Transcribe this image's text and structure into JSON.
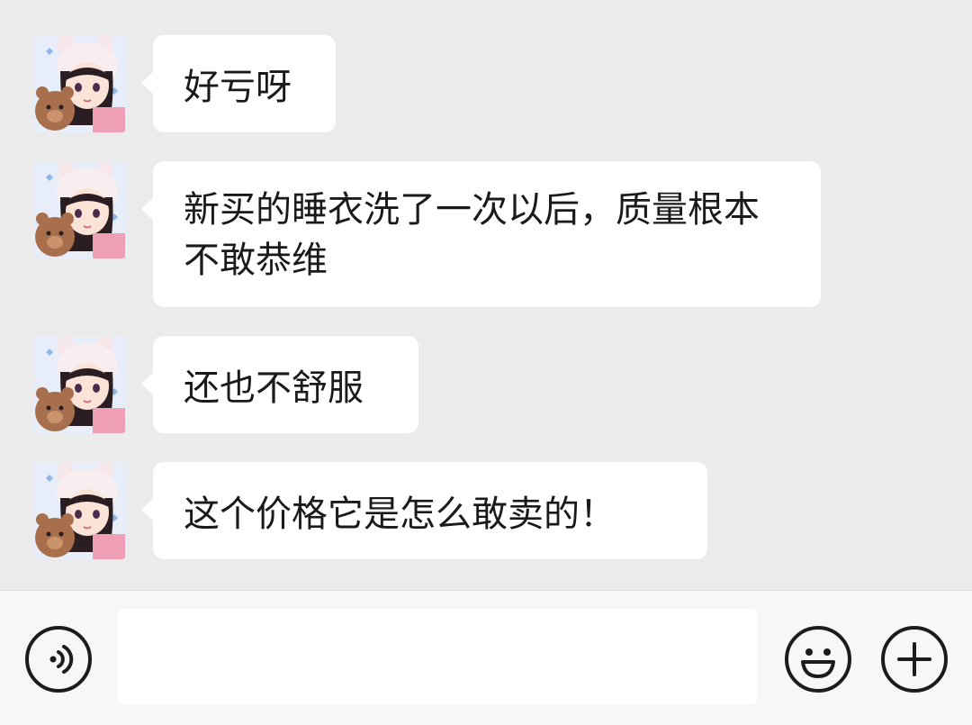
{
  "chat": {
    "messages": [
      {
        "text": "好亏呀"
      },
      {
        "text": "新买的睡衣洗了一次以后，质量根本不敢恭维"
      },
      {
        "text": "还也不舒服"
      },
      {
        "text": "这个价格它是怎么敢卖的！"
      }
    ]
  },
  "input_bar": {
    "message_value": "",
    "placeholder": "",
    "voice_icon": "voice-icon",
    "emoji_icon": "emoji-icon",
    "plus_icon": "plus-icon"
  },
  "colors": {
    "chat_background": "#ebebeb",
    "bubble": "#ffffff",
    "input_bar": "#f7f7f7"
  }
}
